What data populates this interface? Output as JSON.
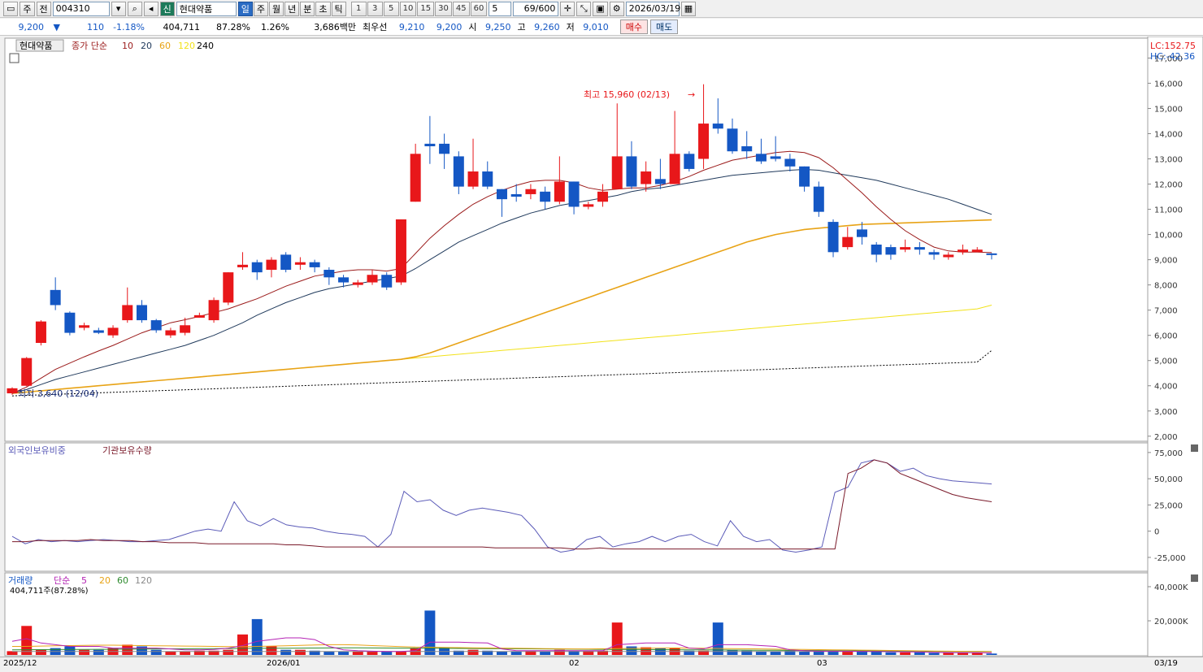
{
  "toolbar": {
    "mode": "주",
    "prev": "전",
    "code": "004310",
    "credit": "신",
    "name": "현대약품",
    "periods": [
      "일",
      "주",
      "월",
      "년",
      "분",
      "초",
      "틱"
    ],
    "active_period": "일",
    "nums": [
      "1",
      "3",
      "5",
      "10",
      "15",
      "30",
      "45",
      "60"
    ],
    "count_sel": "5",
    "count": "69",
    "max": "600",
    "date": "2026/03/19"
  },
  "quote": {
    "price": "9,200",
    "dir": "▼",
    "change": "110",
    "pct": "-1.18%",
    "volume": "404,711",
    "vol_ratio": "87.28%",
    "turnover": "1.26%",
    "amount": "3,686백만",
    "best_label": "최우선",
    "ask": "9,210",
    "bid": "9,200",
    "open_label": "시",
    "open": "9,250",
    "high_label": "고",
    "high": "9,260",
    "low_label": "저",
    "low": "9,010",
    "buy": "매수",
    "sell": "매도"
  },
  "colors": {
    "up": "#e8171a",
    "down": "#1457c4",
    "ma10": "#9b1b1b",
    "ma20": "#203a5c",
    "ma60": "#e8a316",
    "ma120": "#f2e21a",
    "ma240": "#000000",
    "frg": "#5b5bb8",
    "inst": "#7a1a2a",
    "vma5": "#b422b4",
    "vma20": "#e8a316",
    "vma60": "#2e8b2e",
    "vma120": "#8a8a8a"
  },
  "price_panel": {
    "stock": "현대약품",
    "ma_label": "종가 단순",
    "ma_periods": [
      "10",
      "20",
      "60",
      "120",
      "240"
    ],
    "lc": "LC:152.75",
    "hc": "HC:-42.36",
    "high_note": "최고 15,960 (02/13)",
    "low_note": "최저 3,640 (12/04)",
    "yticks": [
      "17,000",
      "16,000",
      "15,000",
      "14,000",
      "13,000",
      "12,000",
      "11,000",
      "10,000",
      "9,000",
      "8,000",
      "7,000",
      "6,000",
      "5,000",
      "4,000",
      "3,000",
      "2,000"
    ]
  },
  "holding_panel": {
    "frg_label": "외국인보유비중",
    "inst_label": "기관보유수량",
    "yticks": [
      "75,000",
      "50,000",
      "25,000",
      "0",
      "-25,000"
    ]
  },
  "volume_panel": {
    "label": "거래량",
    "ma_label": "단순",
    "ma_periods": [
      "5",
      "20",
      "60",
      "120"
    ],
    "current": "404,711주(87.28%)",
    "yticks": [
      "40,000K",
      "20,000K"
    ]
  },
  "xaxis": {
    "labels": [
      "2025/12",
      "2026/01",
      "02",
      "03"
    ],
    "cur": "03/19"
  },
  "chart_data": {
    "type": "candlestick",
    "ylim": [
      1800,
      17400
    ],
    "candles": [
      [
        3700,
        3900,
        3640,
        3940
      ],
      [
        4000,
        5100,
        3980,
        5140
      ],
      [
        5700,
        6550,
        5600,
        6600
      ],
      [
        7800,
        7200,
        7000,
        8300
      ],
      [
        6900,
        6100,
        6000,
        6950
      ],
      [
        6300,
        6400,
        6200,
        6500
      ],
      [
        6200,
        6100,
        6050,
        6300
      ],
      [
        6000,
        6300,
        5900,
        6400
      ],
      [
        6600,
        7200,
        6500,
        7900
      ],
      [
        7200,
        6600,
        6500,
        7400
      ],
      [
        6600,
        6200,
        6100,
        6650
      ],
      [
        6000,
        6200,
        5900,
        6300
      ],
      [
        6100,
        6400,
        6000,
        6700
      ],
      [
        6700,
        6800,
        6700,
        6900
      ],
      [
        6600,
        7400,
        6500,
        7500
      ],
      [
        7300,
        8500,
        7200,
        8500
      ],
      [
        8700,
        8800,
        8600,
        9300
      ],
      [
        8900,
        8500,
        8200,
        9000
      ],
      [
        8600,
        9000,
        8300,
        9100
      ],
      [
        9200,
        8600,
        8500,
        9300
      ],
      [
        8800,
        8900,
        8600,
        9100
      ],
      [
        8900,
        8700,
        8500,
        9000
      ],
      [
        8600,
        8300,
        8000,
        8700
      ],
      [
        8300,
        8100,
        7900,
        8400
      ],
      [
        8000,
        8100,
        7900,
        8200
      ],
      [
        8100,
        8400,
        8000,
        8600
      ],
      [
        8400,
        7900,
        7800,
        8500
      ],
      [
        8100,
        10600,
        8000,
        10600
      ],
      [
        11300,
        13200,
        11300,
        13600
      ],
      [
        13600,
        13500,
        12800,
        14700
      ],
      [
        13600,
        13200,
        12600,
        14000
      ],
      [
        13100,
        11900,
        11600,
        13300
      ],
      [
        11900,
        12500,
        11800,
        13800
      ],
      [
        12500,
        11900,
        11800,
        12900
      ],
      [
        11800,
        11400,
        10700,
        11800
      ],
      [
        11600,
        11500,
        11300,
        12000
      ],
      [
        11600,
        11800,
        11400,
        12000
      ],
      [
        11700,
        11300,
        11000,
        11900
      ],
      [
        11300,
        12100,
        11200,
        13100
      ],
      [
        12100,
        11100,
        10800,
        12100
      ],
      [
        11100,
        11200,
        11000,
        11300
      ],
      [
        11300,
        11700,
        11100,
        12000
      ],
      [
        11800,
        13100,
        11800,
        15200
      ],
      [
        13100,
        11900,
        11800,
        13700
      ],
      [
        12000,
        12500,
        11700,
        12900
      ],
      [
        12200,
        12000,
        11800,
        13000
      ],
      [
        12000,
        13200,
        12000,
        14900
      ],
      [
        13200,
        12600,
        12500,
        13300
      ],
      [
        13000,
        14400,
        12600,
        15960
      ],
      [
        14400,
        14200,
        14000,
        15400
      ],
      [
        14200,
        13300,
        13200,
        14600
      ],
      [
        13500,
        13300,
        13000,
        14100
      ],
      [
        13200,
        12900,
        12800,
        13800
      ],
      [
        13100,
        13000,
        12900,
        13900
      ],
      [
        13000,
        12700,
        12500,
        13200
      ],
      [
        12700,
        11900,
        11700,
        12700
      ],
      [
        11900,
        10900,
        10700,
        12100
      ],
      [
        10500,
        9300,
        9100,
        10600
      ],
      [
        9500,
        9900,
        9400,
        10300
      ],
      [
        10200,
        9900,
        9600,
        10500
      ],
      [
        9600,
        9200,
        8900,
        9700
      ],
      [
        9500,
        9200,
        9000,
        9600
      ],
      [
        9400,
        9500,
        9300,
        9800
      ],
      [
        9500,
        9400,
        9200,
        9700
      ],
      [
        9300,
        9200,
        9000,
        9400
      ],
      [
        9100,
        9200,
        9000,
        9300
      ],
      [
        9300,
        9400,
        9200,
        9600
      ],
      [
        9300,
        9400,
        9300,
        9500
      ],
      [
        9250,
        9200,
        9010,
        9260
      ]
    ],
    "ma10": [
      3700,
      3950,
      4300,
      4650,
      4900,
      5150,
      5380,
      5600,
      5850,
      6100,
      6300,
      6500,
      6620,
      6750,
      6900,
      7050,
      7250,
      7450,
      7700,
      7950,
      8150,
      8350,
      8450,
      8550,
      8600,
      8600,
      8550,
      8650,
      9250,
      9850,
      10350,
      10800,
      11200,
      11500,
      11750,
      11950,
      12100,
      12150,
      12150,
      12050,
      11850,
      11750,
      11800,
      11850,
      11850,
      11950,
      12100,
      12300,
      12550,
      12750,
      12950,
      13050,
      13150,
      13250,
      13300,
      13250,
      13050,
      12650,
      12150,
      11650,
      11100,
      10600,
      10150,
      9800,
      9500,
      9350,
      9300,
      9300,
      9280
    ],
    "ma20": [
      3700,
      3850,
      4050,
      4250,
      4400,
      4550,
      4700,
      4850,
      5000,
      5150,
      5300,
      5450,
      5600,
      5800,
      6000,
      6250,
      6500,
      6800,
      7050,
      7300,
      7500,
      7700,
      7850,
      7950,
      8050,
      8150,
      8250,
      8350,
      8650,
      9000,
      9350,
      9700,
      9950,
      10200,
      10450,
      10650,
      10850,
      11000,
      11150,
      11250,
      11350,
      11450,
      11550,
      11700,
      11800,
      11850,
      11950,
      12050,
      12150,
      12250,
      12350,
      12400,
      12450,
      12500,
      12550,
      12580,
      12550,
      12450,
      12350,
      12250,
      12150,
      12000,
      11850,
      11700,
      11550,
      11400,
      11200,
      11000,
      10800
    ],
    "ma60": [
      3700,
      3750,
      3800,
      3850,
      3900,
      3950,
      4000,
      4050,
      4100,
      4150,
      4200,
      4250,
      4300,
      4350,
      4400,
      4450,
      4500,
      4550,
      4600,
      4650,
      4700,
      4750,
      4800,
      4850,
      4900,
      4950,
      5000,
      5050,
      5150,
      5300,
      5500,
      5700,
      5900,
      6100,
      6300,
      6500,
      6700,
      6900,
      7100,
      7300,
      7500,
      7700,
      7900,
      8100,
      8300,
      8500,
      8700,
      8900,
      9100,
      9300,
      9500,
      9700,
      9850,
      10000,
      10100,
      10200,
      10250,
      10300,
      10350,
      10400,
      10420,
      10440,
      10460,
      10480,
      10500,
      10520,
      10540,
      10560,
      10580
    ],
    "ma120": [
      3700,
      3750,
      3800,
      3850,
      3900,
      3950,
      4000,
      4050,
      4100,
      4150,
      4200,
      4250,
      4300,
      4350,
      4400,
      4450,
      4500,
      4550,
      4600,
      4650,
      4700,
      4750,
      4800,
      4850,
      4900,
      4950,
      5000,
      5050,
      5100,
      5150,
      5200,
      5250,
      5300,
      5350,
      5400,
      5450,
      5500,
      5550,
      5600,
      5650,
      5700,
      5750,
      5800,
      5850,
      5900,
      5950,
      6000,
      6050,
      6100,
      6150,
      6200,
      6250,
      6300,
      6350,
      6400,
      6450,
      6500,
      6550,
      6600,
      6650,
      6700,
      6750,
      6800,
      6850,
      6900,
      6950,
      7000,
      7050,
      7200
    ],
    "ma240": [
      3600,
      3620,
      3640,
      3660,
      3680,
      3700,
      3720,
      3740,
      3760,
      3780,
      3800,
      3820,
      3840,
      3860,
      3880,
      3900,
      3920,
      3940,
      3960,
      3980,
      4000,
      4020,
      4040,
      4060,
      4080,
      4100,
      4120,
      4140,
      4160,
      4180,
      4200,
      4220,
      4240,
      4260,
      4280,
      4300,
      4320,
      4340,
      4360,
      4380,
      4400,
      4420,
      4440,
      4460,
      4480,
      4500,
      4520,
      4540,
      4560,
      4580,
      4600,
      4620,
      4640,
      4660,
      4680,
      4700,
      4720,
      4740,
      4760,
      4780,
      4800,
      4820,
      4840,
      4860,
      4880,
      4900,
      4920,
      4940,
      5400
    ],
    "frg": [
      -5000,
      -12000,
      -8000,
      -10000,
      -9000,
      -10000,
      -9000,
      -8000,
      -9000,
      -10000,
      -10000,
      -9000,
      -8000,
      -4000,
      0,
      2000,
      0,
      28000,
      10000,
      5000,
      12000,
      6000,
      4000,
      3000,
      0,
      -2000,
      -3000,
      -5000,
      -15000,
      -3000,
      38000,
      28000,
      30000,
      20000,
      15000,
      20000,
      22000,
      20000,
      18000,
      15000,
      2000,
      -15000,
      -20000,
      -18000,
      -8000,
      -5000,
      -15000,
      -12000,
      -10000,
      -5000,
      -10000,
      -5000,
      -3000,
      -10000,
      -14000,
      10000,
      -5000,
      -10000,
      -8000,
      -18000,
      -20000,
      -18000,
      -15000,
      37000,
      42000,
      65000,
      68000,
      65000,
      57000,
      60000,
      53000,
      50000,
      48000,
      47000,
      46000,
      45000
    ],
    "inst": [
      -10000,
      -10000,
      -9000,
      -9000,
      -9000,
      -9000,
      -8000,
      -9000,
      -9000,
      -9000,
      -10000,
      -10000,
      -11000,
      -11000,
      -11000,
      -12000,
      -12000,
      -12000,
      -12000,
      -12000,
      -12000,
      -13000,
      -13000,
      -14000,
      -15000,
      -15000,
      -15000,
      -15000,
      -15000,
      -15000,
      -15000,
      -15000,
      -15000,
      -15000,
      -15000,
      -15000,
      -15000,
      -16000,
      -16000,
      -16000,
      -16000,
      -16000,
      -16000,
      -17000,
      -17000,
      -16000,
      -17000,
      -17000,
      -17000,
      -17000,
      -17000,
      -17000,
      -17000,
      -17000,
      -17000,
      -17000,
      -17000,
      -17000,
      -17000,
      -17000,
      -17000,
      -17000,
      -17000,
      -17000,
      55000,
      60000,
      68000,
      65000,
      55000,
      50000,
      45000,
      40000,
      35000,
      32000,
      30000,
      28000
    ],
    "volume": [
      2200,
      17000,
      3000,
      4000,
      5000,
      3000,
      3000,
      4000,
      6000,
      5000,
      3000,
      2000,
      2000,
      2500,
      2500,
      3000,
      12000,
      21000,
      5000,
      3000,
      3000,
      2500,
      2000,
      2000,
      2000,
      2000,
      2000,
      2000,
      4000,
      26000,
      4500,
      2500,
      3000,
      2500,
      2000,
      2000,
      2500,
      2000,
      3000,
      2500,
      2500,
      2500,
      19000,
      5000,
      4500,
      4000,
      4000,
      2500,
      2500,
      19000,
      3000,
      2500,
      2000,
      2000,
      2500,
      2000,
      2000,
      2500,
      2000,
      2000,
      2000,
      1500,
      1500,
      1500,
      1200,
      1200,
      1200,
      1200,
      800
    ],
    "vma5": [
      8000,
      9500,
      7000,
      6000,
      5000,
      5000,
      5000,
      4000,
      4000,
      4000,
      4000,
      3500,
      3000,
      3000,
      3200,
      4000,
      5500,
      8000,
      9000,
      10000,
      10000,
      9000,
      5000,
      3000,
      2500,
      2200,
      2000,
      2000,
      2500,
      7500,
      7500,
      7500,
      7200,
      7000,
      3500,
      2500,
      2500,
      2500,
      2500,
      2500,
      2500,
      2500,
      6000,
      6500,
      7000,
      7000,
      7000,
      4000,
      3500,
      6000,
      6000,
      6000,
      5500,
      5000,
      3000,
      2500,
      2200,
      2200,
      2200,
      2100,
      2000,
      1900,
      1800,
      1700,
      1500,
      1400,
      1300,
      1300,
      1200
    ],
    "vma20": [
      5000,
      5000,
      5200,
      5400,
      5500,
      5600,
      5700,
      5700,
      5600,
      5500,
      5400,
      5300,
      5200,
      5100,
      5000,
      4900,
      4800,
      5000,
      5200,
      5400,
      5600,
      5800,
      6000,
      6000,
      5800,
      5500,
      5200,
      4900,
      4600,
      4500,
      4400,
      4300,
      4200,
      4100,
      4000,
      3900,
      3800,
      3700,
      3600,
      3500,
      3500,
      3600,
      3700,
      3800,
      3900,
      4000,
      4100,
      4000,
      3900,
      3800,
      3700,
      3600,
      3500,
      3400,
      3300,
      3200,
      3100,
      3000,
      2900,
      2800,
      2700,
      2600,
      2500,
      2400,
      2300,
      2200,
      2100,
      2000,
      1900
    ],
    "vma60": [
      3000,
      3050,
      3100,
      3150,
      3200,
      3250,
      3300,
      3350,
      3400,
      3450,
      3500,
      3550,
      3600,
      3650,
      3700,
      3750,
      3800,
      3850,
      3900,
      3950,
      4000,
      4050,
      4100,
      4150,
      4150,
      4100,
      4050,
      4000,
      3950,
      3900,
      3850,
      3800,
      3750,
      3700,
      3650,
      3600,
      3550,
      3500,
      3450,
      3400,
      3350,
      3300,
      3250,
      3200,
      3150,
      3100,
      3050,
      3000,
      2950,
      2900,
      2850,
      2800,
      2750,
      2700,
      2650,
      2600,
      2550,
      2500,
      2450,
      2400,
      2350,
      2300,
      2250,
      2200,
      2150,
      2100,
      2050,
      2000,
      1950
    ],
    "vma120": [
      2000,
      2000,
      2000,
      2000,
      2000,
      2000,
      2000,
      2000,
      2000,
      2000,
      2000,
      2000,
      2000,
      2000,
      2000,
      2000,
      2000,
      2000,
      2000,
      2000,
      2000,
      2000,
      2000,
      2000,
      2000,
      2000,
      2000,
      2000,
      2000,
      2000,
      2000,
      2000,
      2000,
      2000,
      2000,
      2000,
      2000,
      2000,
      2000,
      2000,
      2000,
      2000,
      2000,
      2000,
      2000,
      2000,
      2000,
      2000,
      2000,
      2000,
      2000,
      2000,
      2000,
      2000,
      2000,
      2000,
      2000,
      2000,
      2000,
      2000,
      2000,
      2000,
      2000,
      2000,
      2000,
      2000,
      2000,
      2000,
      2000
    ]
  }
}
